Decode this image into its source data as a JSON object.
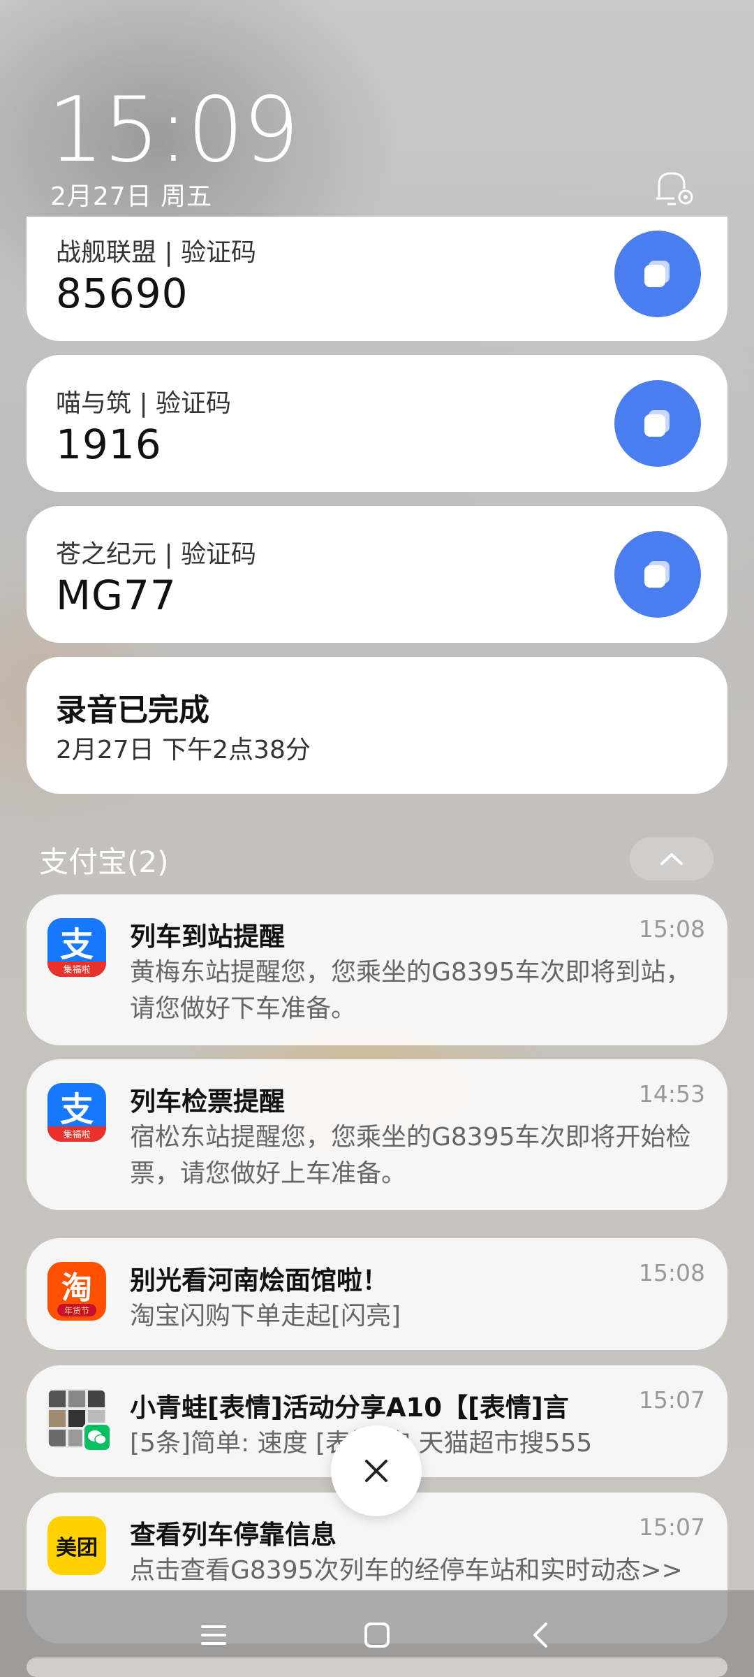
{
  "lockscreen": {
    "time": "15:09",
    "date": "2月27日 周五"
  },
  "otp_cards": [
    {
      "label": "战舰联盟 | 验证码",
      "code": "85690"
    },
    {
      "label": "喵与筑 | 验证码",
      "code": "1916"
    },
    {
      "label": "苍之纪元 | 验证码",
      "code": "MG77"
    }
  ],
  "recording": {
    "title": "录音已完成",
    "time": "2月27日 下午2点38分"
  },
  "group": {
    "title": "支付宝(2)"
  },
  "notifications": [
    {
      "app_icon": "alipay-icon",
      "badge": "集福啦",
      "title": "列车到站提醒",
      "time": "15:08",
      "body": "黄梅东站提醒您，您乘坐的G8395车次即将到站，请您做好下车准备。"
    },
    {
      "app_icon": "alipay-icon",
      "badge": "集福啦",
      "title": "列车检票提醒",
      "time": "14:53",
      "body": "宿松东站提醒您，您乘坐的G8395车次即将开始检票，请您做好上车准备。"
    },
    {
      "app_icon": "taobao-icon",
      "badge": "年货节",
      "glyph": "淘",
      "title": "别光看河南烩面馆啦！",
      "time": "15:08",
      "body": "淘宝闪购下单走起[闪亮]"
    },
    {
      "app_icon": "wechat-group-avatar",
      "title": "小青蛙[表情]活动分享A10【[表情]言",
      "time": "15:07",
      "body": "[5条]简单: 速度 [表情]宝 天猫超市搜555"
    },
    {
      "app_icon": "meituan-icon",
      "glyph": "美团",
      "title": "查看列车停靠信息",
      "time": "15:07",
      "body": "点击查看G8395次列车的经停车站和实时动态>>"
    }
  ],
  "colors": {
    "accent_blue": "#4a7ef0",
    "alipay_blue": "#1677ff",
    "taobao_orange": "#ff5000",
    "meituan_yellow": "#ffd100"
  }
}
